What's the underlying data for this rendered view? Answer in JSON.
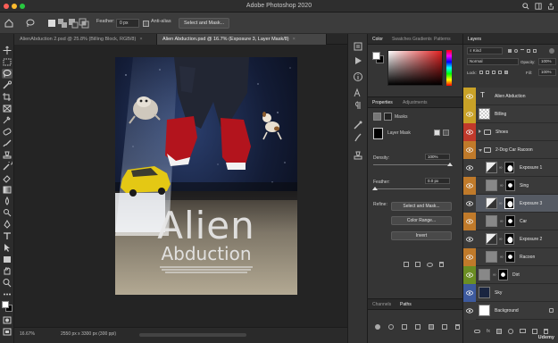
{
  "window": {
    "title": "Adobe Photoshop 2020",
    "traffic_colors": [
      "#ff5f57",
      "#febc2e",
      "#28c840"
    ]
  },
  "options_bar": {
    "feather_label": "Feather:",
    "feather_value": "0 px",
    "anti_alias_label": "Anti-alias",
    "select_mask_label": "Select and Mask..."
  },
  "document_tabs": [
    {
      "label": "AlienAbduction 2.psd @ 25.8% (Billing Block, RGB/8)",
      "close": "×"
    },
    {
      "label": "Alien Abduction.psd @ 16.7% (Exposure 3, Layer Mask/8)",
      "close": "×"
    }
  ],
  "poster": {
    "title": "Alien",
    "subtitle": "Abduction"
  },
  "status_bar": {
    "zoom": "16.67%",
    "doc_info": "2550 px x 3300 px (300 ppi)"
  },
  "color_panel": {
    "tabs": [
      "Color",
      "Swatches",
      "Gradients",
      "Patterns"
    ]
  },
  "properties_panel": {
    "tabs": [
      "Properties",
      "Adjustments"
    ],
    "masks_label": "Masks",
    "layer_mask_label": "Layer Mask",
    "density_label": "Density:",
    "density_value": "100%",
    "feather_label": "Feather:",
    "feather_value": "0.0 px",
    "refine_label": "Refine:",
    "select_mask_button": "Select and Mask...",
    "color_range_button": "Color Range...",
    "invert_button": "Invert"
  },
  "channels_panel": {
    "tabs": [
      "Channels",
      "Paths"
    ]
  },
  "layers_panel": {
    "tab": "Layers",
    "kind_label": "Kind",
    "blend_mode": "Normal",
    "opacity_label": "Opacity:",
    "opacity_value": "100%",
    "lock_label": "Lock:",
    "fill_label": "Fill:",
    "fill_value": "100%",
    "layers": [
      {
        "name": "Alien Abduction",
        "type": "text",
        "tag_color": "#c9a227",
        "selected": false,
        "indent": 0
      },
      {
        "name": "Billing",
        "type": "pixel",
        "tag_color": "#c9a227",
        "selected": false,
        "indent": 0
      },
      {
        "name": "Shoes",
        "type": "group-closed",
        "tag_color": "#c0392b",
        "selected": false,
        "indent": 0
      },
      {
        "name": "2-Dog Car Racoon",
        "type": "group-open",
        "tag_color": "#c07a2a",
        "selected": false,
        "indent": 0
      },
      {
        "name": "Exposure 1",
        "type": "adjust",
        "tag_color": "#3a3a3a",
        "selected": false,
        "indent": 1
      },
      {
        "name": "Sing",
        "type": "pixel-mask",
        "tag_color": "#c07a2a",
        "selected": false,
        "indent": 1
      },
      {
        "name": "Exposure 3",
        "type": "adjust",
        "tag_color": "#3a3a3a",
        "selected": true,
        "indent": 1
      },
      {
        "name": "Car",
        "type": "pixel-mask",
        "tag_color": "#c07a2a",
        "selected": false,
        "indent": 1
      },
      {
        "name": "Exposure 2",
        "type": "adjust",
        "tag_color": "#3a3a3a",
        "selected": false,
        "indent": 1
      },
      {
        "name": "Racoon",
        "type": "pixel-mask",
        "tag_color": "#c07a2a",
        "selected": false,
        "indent": 1
      },
      {
        "name": "Dirt",
        "type": "pixel-mask",
        "tag_color": "#6b8e23",
        "selected": false,
        "indent": 0
      },
      {
        "name": "Sky",
        "type": "pixel",
        "tag_color": "#3d5a9e",
        "selected": false,
        "indent": 0
      },
      {
        "name": "Background",
        "type": "background",
        "tag_color": "#3a3a3a",
        "selected": false,
        "indent": 0
      }
    ]
  },
  "watermark": "Udemy"
}
